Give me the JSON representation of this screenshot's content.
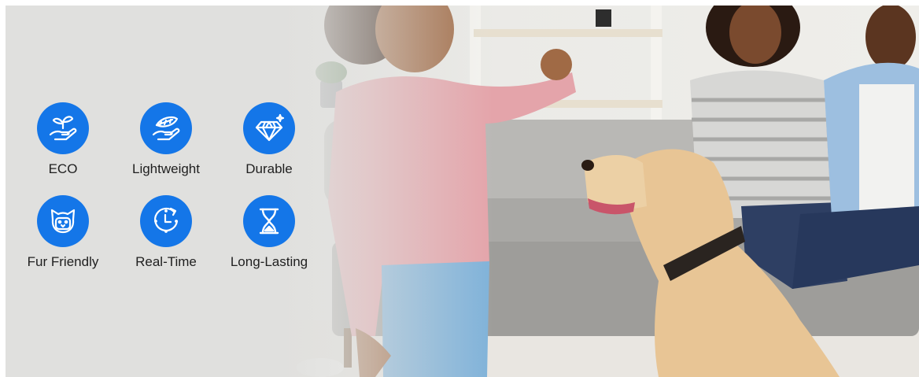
{
  "features": [
    {
      "label": "ECO",
      "icon": "eco-sprout-hand-icon"
    },
    {
      "label": "Lightweight",
      "icon": "feather-hand-icon"
    },
    {
      "label": "Durable",
      "icon": "diamond-icon"
    },
    {
      "label": "Fur Friendly",
      "icon": "pet-face-icon"
    },
    {
      "label": "Real-Time",
      "icon": "clock-icon"
    },
    {
      "label": "Long-Lasting",
      "icon": "hourglass-icon"
    }
  ],
  "colors": {
    "accent": "#1476e8",
    "background": "#e2e2df",
    "text": "#1f1f1f"
  }
}
